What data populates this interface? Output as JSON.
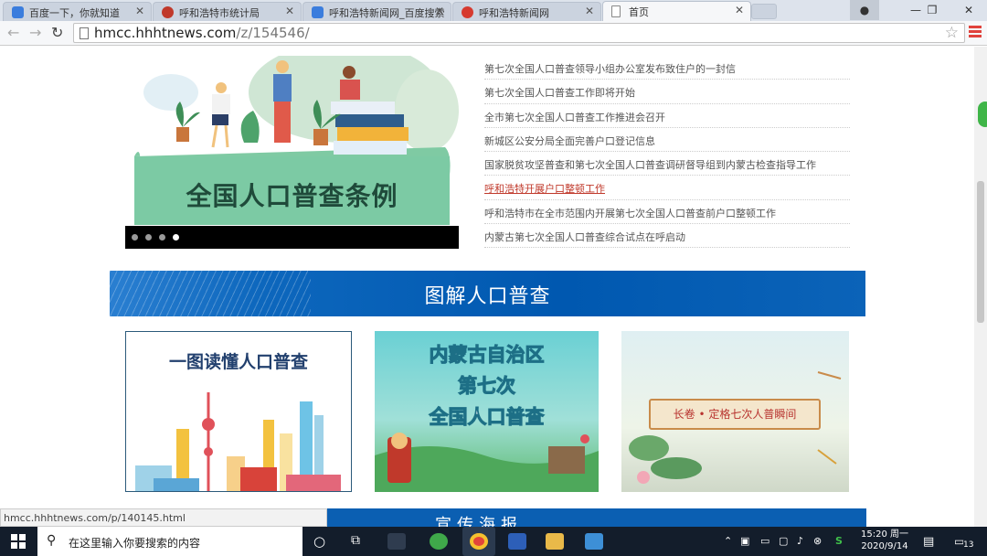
{
  "browser": {
    "tabs": [
      {
        "label": "百度一下，你就知道",
        "color": "#3b7ddd"
      },
      {
        "label": "呼和浩特市统计局",
        "color": "#c0392b"
      },
      {
        "label": "呼和浩特新闻网_百度搜索",
        "color": "#3b7ddd"
      },
      {
        "label": "呼和浩特新闻网",
        "color": "#d63a2f"
      },
      {
        "label": "首页",
        "color": "#ffffff"
      }
    ],
    "url_host": "hmcc.hhhtnews.com",
    "url_path": "/z/154546/"
  },
  "banner": {
    "caption": "全国人口普查条例",
    "slide_count": 4,
    "active_slide": 4
  },
  "news": [
    {
      "title": "第七次全国人口普查领导小组办公室发布致住户的一封信",
      "highlight": false
    },
    {
      "title": "第七次全国人口普查工作即将开始",
      "highlight": false
    },
    {
      "title": "全市第七次全国人口普查工作推进会召开",
      "highlight": false
    },
    {
      "title": "新城区公安分局全面完善户口登记信息",
      "highlight": false
    },
    {
      "title": "国家脱贫攻坚普查和第七次全国人口普查调研督导组到内蒙古检查指导工作",
      "highlight": false
    },
    {
      "title": "呼和浩特开展户口整顿工作",
      "highlight": true
    },
    {
      "title": "呼和浩特市在全市范围内开展第七次全国人口普查前户口整顿工作",
      "highlight": false
    },
    {
      "title": "内蒙古第七次全国人口普查综合试点在呼启动",
      "highlight": false
    }
  ],
  "section": {
    "title": "图解人口普查"
  },
  "cards": [
    {
      "title": "一图读懂人口普查"
    },
    {
      "line1": "内蒙古自治区",
      "line2a": "第",
      "line2b": "七",
      "line2c": "次",
      "line3": "全国人口普查"
    },
    {
      "title": "长卷 • 定格七次人普瞬间"
    }
  ],
  "status_url": "hmcc.hhhtnews.com/p/140145.html",
  "bottom_section": {
    "title": "宣传海报"
  },
  "taskbar": {
    "search_placeholder": "在这里输入你要搜索的内容",
    "time": "15:20 周一",
    "date": "2020/9/14",
    "notification_count": "13"
  }
}
